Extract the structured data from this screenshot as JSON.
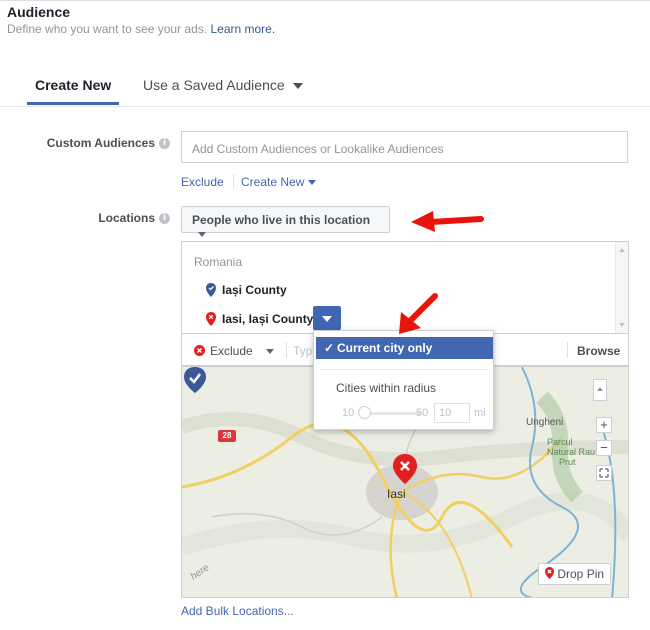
{
  "header": {
    "title": "Audience",
    "subtitle": "Define who you want to see your ads.",
    "learn_more": "Learn more."
  },
  "tabs": [
    {
      "label": "Create New",
      "active": true
    },
    {
      "label": "Use a Saved Audience",
      "active": false
    }
  ],
  "custom_audiences": {
    "label": "Custom Audiences",
    "placeholder": "Add Custom Audiences or Lookalike Audiences",
    "exclude": "Exclude",
    "create_new": "Create New"
  },
  "locations": {
    "label": "Locations",
    "selector": "People who live in this location",
    "country": "Romania",
    "items": [
      {
        "name": "Iași County",
        "type": "include"
      },
      {
        "name": "Iasi, Iași County",
        "type": "exclude"
      }
    ],
    "search_mode": "Exclude",
    "search_placeholder": "Typ",
    "browse": "Browse",
    "bulk": "Add Bulk Locations..."
  },
  "radius_popup": {
    "option_current": "Current city only",
    "option_radius": "Cities within radius",
    "slider_min": "10",
    "slider_max": "50",
    "value": "10",
    "unit": "mi"
  },
  "map": {
    "city": "Iasi",
    "place": "Ungheni",
    "park_line1": "Parcul",
    "park_line2": "Natural Rau",
    "park_line3": "Prut",
    "road": "28",
    "drop_pin": "Drop Pin",
    "watermark": "here"
  },
  "colors": {
    "accent": "#4267b2",
    "exclude_red": "#e02020",
    "include_blue": "#3b5998",
    "annotation_arrow": "#e8140c"
  }
}
